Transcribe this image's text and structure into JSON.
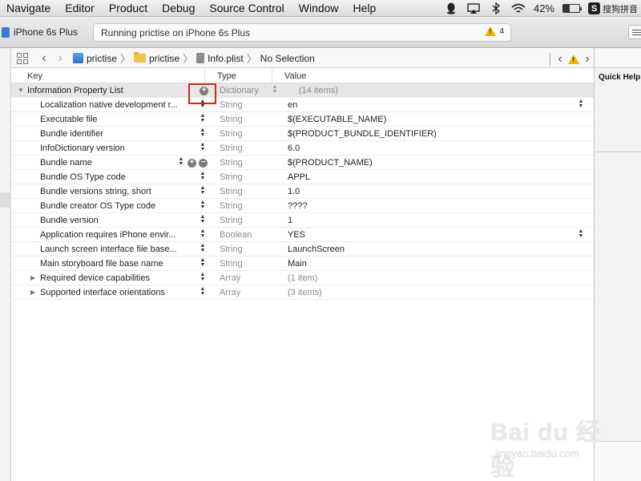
{
  "menubar": {
    "items": [
      "Navigate",
      "Editor",
      "Product",
      "Debug",
      "Source Control",
      "Window",
      "Help"
    ],
    "battery_percent": "42%",
    "ime_label": "搜狗拼音"
  },
  "toolbar": {
    "scheme_device": "iPhone 6s Plus",
    "activity_text": "Running prictise on iPhone 6s Plus",
    "warning_count": "4"
  },
  "jumpbar": {
    "crumbs": [
      "prictise",
      "prictise",
      "Info.plist",
      "No Selection"
    ]
  },
  "utilities": {
    "title": "Quick Help"
  },
  "plist": {
    "headers": {
      "key": "Key",
      "type": "Type",
      "value": "Value"
    },
    "root": {
      "key": "Information Property List",
      "type": "Dictionary",
      "value": "(14 items)"
    },
    "rows": [
      {
        "key": "Localization native development r...",
        "type": "String",
        "value": "en"
      },
      {
        "key": "Executable file",
        "type": "String",
        "value": "$(EXECUTABLE_NAME)"
      },
      {
        "key": "Bundle identifier",
        "type": "String",
        "value": "$(PRODUCT_BUNDLE_IDENTIFIER)"
      },
      {
        "key": "InfoDictionary version",
        "type": "String",
        "value": "6.0"
      },
      {
        "key": "Bundle name",
        "type": "String",
        "value": "$(PRODUCT_NAME)"
      },
      {
        "key": "Bundle OS Type code",
        "type": "String",
        "value": "APPL"
      },
      {
        "key": "Bundle versions string, short",
        "type": "String",
        "value": "1.0"
      },
      {
        "key": "Bundle creator OS Type code",
        "type": "String",
        "value": "????"
      },
      {
        "key": "Bundle version",
        "type": "String",
        "value": "1"
      },
      {
        "key": "Application requires iPhone envir...",
        "type": "Boolean",
        "value": "YES"
      },
      {
        "key": "Launch screen interface file base...",
        "type": "String",
        "value": "LaunchScreen"
      },
      {
        "key": "Main storyboard file base name",
        "type": "String",
        "value": "Main"
      },
      {
        "key": "Required device capabilities",
        "type": "Array",
        "value": "(1 item)"
      },
      {
        "key": "Supported interface orientations",
        "type": "Array",
        "value": "(3 items)"
      }
    ]
  },
  "watermark": {
    "main": "Bai du 经验",
    "sub": "jingyan.baidu.com"
  }
}
